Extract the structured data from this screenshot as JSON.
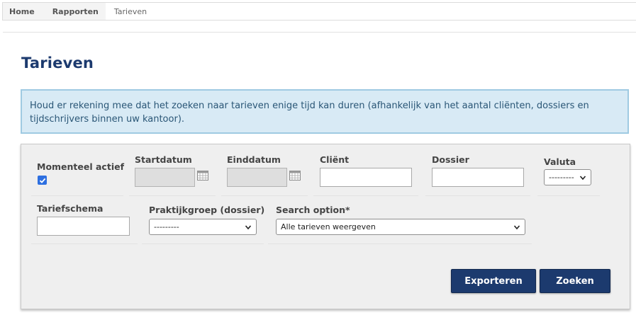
{
  "breadcrumb": {
    "items": [
      "Home",
      "Rapporten"
    ],
    "current": "Tarieven"
  },
  "page": {
    "title": "Tarieven"
  },
  "info": {
    "message": "Houd er rekening mee dat het zoeken naar tarieven enige tijd kan duren (afhankelijk van het aantal cliënten, dossiers en tijdschrijvers binnen uw kantoor)."
  },
  "filters": {
    "momenteel_actief": {
      "label": "Momenteel actief",
      "checked": true
    },
    "startdatum": {
      "label": "Startdatum",
      "value": ""
    },
    "einddatum": {
      "label": "Einddatum",
      "value": ""
    },
    "client": {
      "label": "Cliënt",
      "value": ""
    },
    "dossier": {
      "label": "Dossier",
      "value": ""
    },
    "valuta": {
      "label": "Valuta",
      "selected": "---------"
    },
    "tariefschema": {
      "label": "Tariefschema",
      "value": ""
    },
    "praktijkgroep": {
      "label": "Praktijkgroep (dossier)",
      "selected": "---------"
    },
    "search_option": {
      "label": "Search option*",
      "selected": "Alle tarieven weergeven"
    }
  },
  "actions": {
    "export_label": "Exporteren",
    "search_label": "Zoeken"
  },
  "colors": {
    "primary": "#1c3a6e",
    "info_bg": "#d8eaf5",
    "info_border": "#9fcae2",
    "checkbox": "#2d6fe0"
  }
}
